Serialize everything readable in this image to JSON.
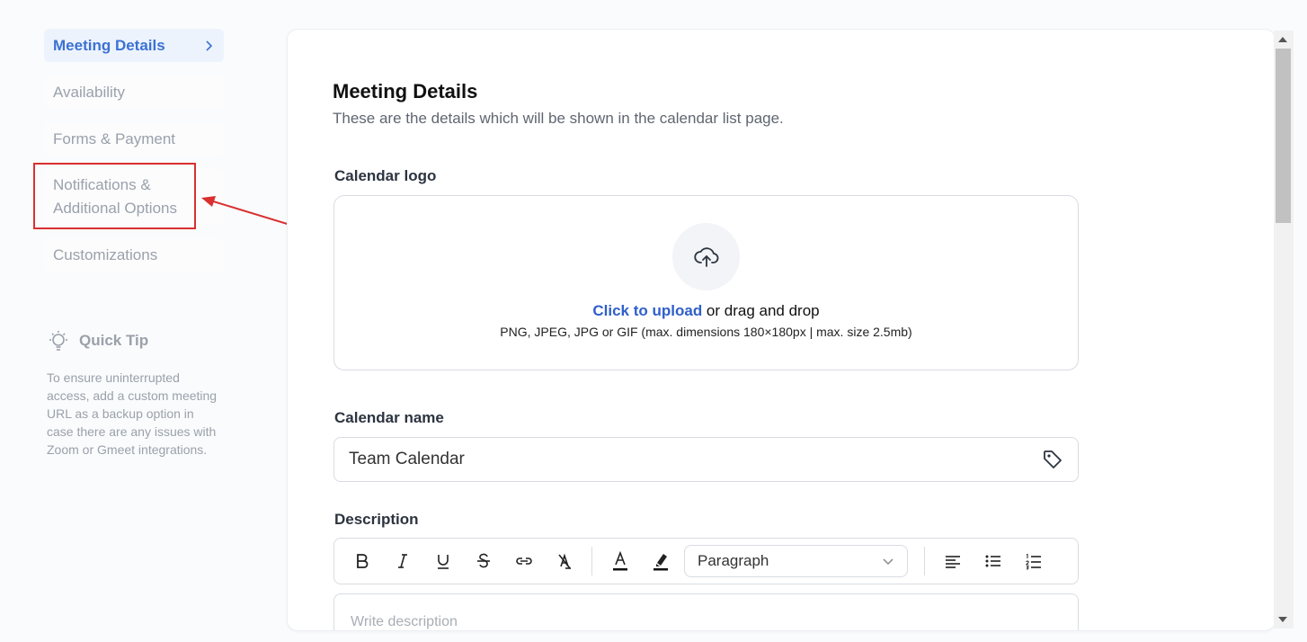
{
  "sidebar": {
    "items": [
      {
        "label": "Meeting Details"
      },
      {
        "label": "Availability"
      },
      {
        "label": "Forms & Payment"
      },
      {
        "label": "Notifications &\nAdditional Options"
      },
      {
        "label": "Customizations"
      }
    ]
  },
  "quick_tip": {
    "title": "Quick Tip",
    "body": "To ensure uninterrupted access, add a custom meeting URL as a backup option in case there are any issues with Zoom or Gmeet integrations."
  },
  "main": {
    "title": "Meeting Details",
    "subtitle": "These are the details which will be shown in the calendar list page.",
    "logo_label": "Calendar logo",
    "upload_link": "Click to upload",
    "upload_rest": " or drag and drop",
    "upload_hint": "PNG, JPEG, JPG or GIF (max. dimensions 180×180px | max. size 2.5mb)",
    "name_label": "Calendar name",
    "name_value": "Team Calendar",
    "description_label": "Description",
    "paragraph_select": "Paragraph",
    "description_placeholder": "Write description"
  },
  "colors": {
    "accent": "#3b72d3",
    "annotation": "#d93030"
  }
}
